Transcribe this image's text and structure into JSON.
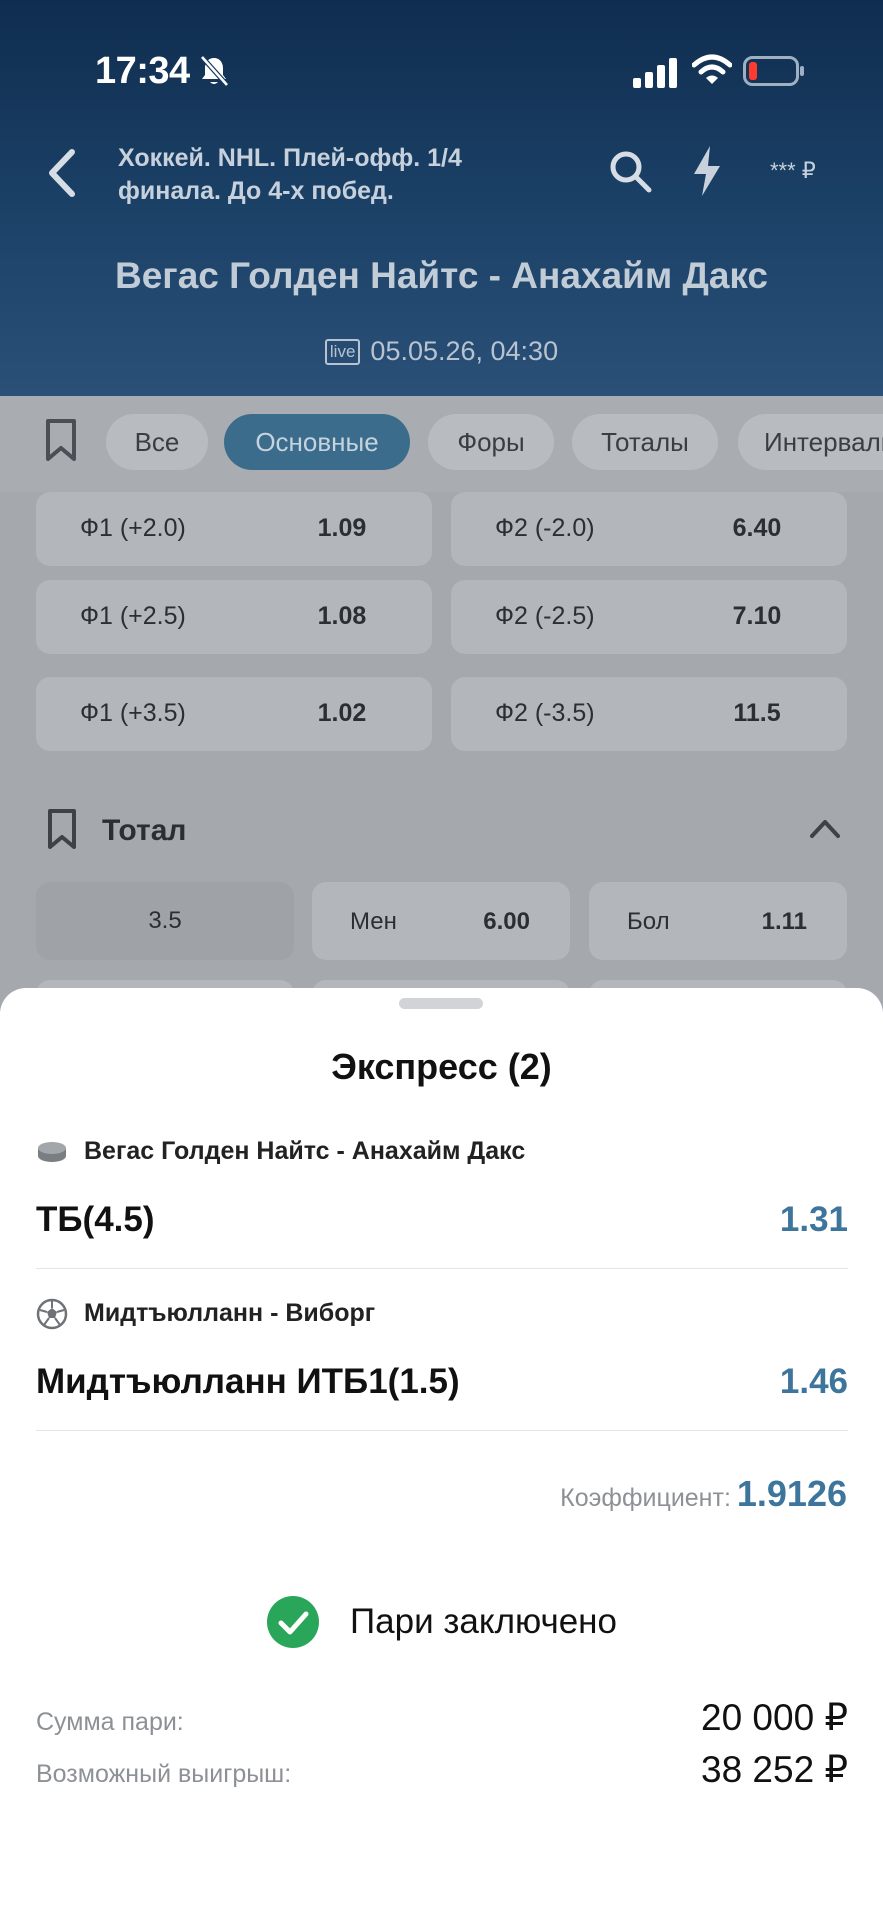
{
  "status_bar": {
    "time": "17:34"
  },
  "header": {
    "league": "Хоккей. NHL. Плей-офф. 1/4 финала. До 4-х побед.",
    "balance": "*** ₽",
    "match_title": "Вегас Голден Найтс - Анахайм Дакс",
    "live_badge": "live",
    "datetime": "05.05.26, 04:30"
  },
  "tabs": [
    "Все",
    "Основные",
    "Форы",
    "Тоталы",
    "Интервалы"
  ],
  "handicap_rows": [
    {
      "left_label": "Ф1 (+2.0)",
      "left_odds": "1.09",
      "right_label": "Ф2 (-2.0)",
      "right_odds": "6.40"
    },
    {
      "left_label": "Ф1 (+2.5)",
      "left_odds": "1.08",
      "right_label": "Ф2 (-2.5)",
      "right_odds": "7.10"
    },
    {
      "left_label": "Ф1 (+3.5)",
      "left_odds": "1.02",
      "right_label": "Ф2 (-3.5)",
      "right_odds": "11.5"
    }
  ],
  "total_section": {
    "title": "Тотал",
    "line": "3.5",
    "under_label": "Мен",
    "under_odds": "6.00",
    "over_label": "Бол",
    "over_odds": "1.11"
  },
  "sheet": {
    "title": "Экспресс (2)",
    "bets": [
      {
        "event": "Вегас Голден Найтс - Анахайм Дакс",
        "sport_icon": "hockey-puck-icon",
        "market": "ТБ(4.5)",
        "odds": "1.31"
      },
      {
        "event": "Мидтъюлланн - Виборг",
        "sport_icon": "soccer-ball-icon",
        "market": "Мидтъюлланн ИТБ1(1.5)",
        "odds": "1.46"
      }
    ],
    "coef_label": "Коэффициент:",
    "coef_value": "1.9126",
    "status": "Пари заключено",
    "stake_label": "Сумма пари:",
    "stake_value": "20 000 ₽",
    "win_label": "Возможный выигрыш:",
    "win_value": "38 252 ₽"
  },
  "colors": {
    "accent": "#3e759c",
    "success": "#2aa65a",
    "header": "#1c4268"
  }
}
